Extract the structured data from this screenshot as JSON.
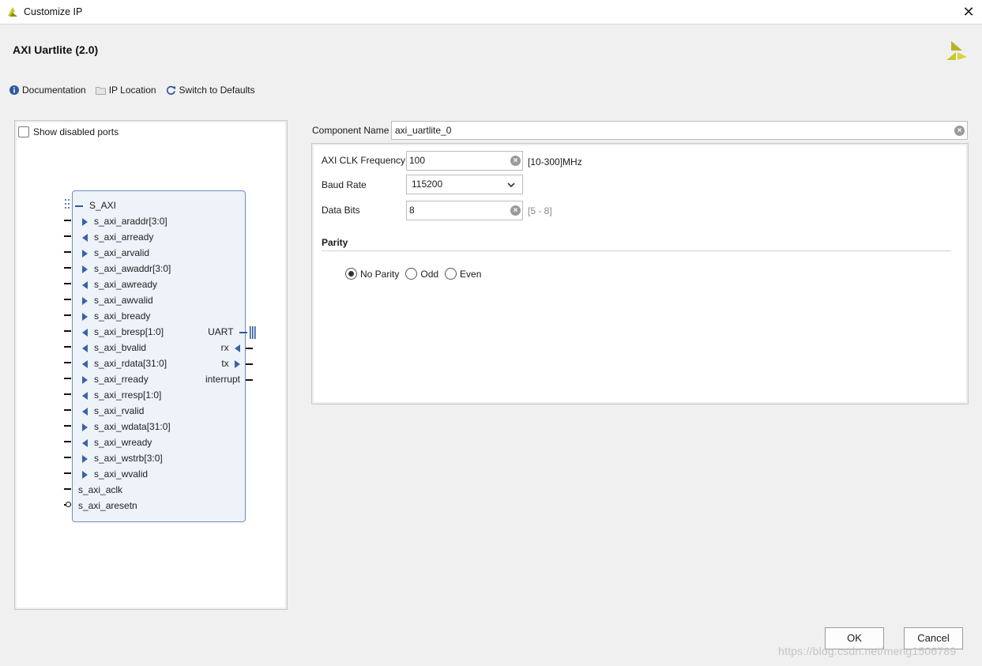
{
  "window": {
    "title": "Customize IP",
    "close_glyph": "✕"
  },
  "header": {
    "title": "AXI Uartlite (2.0)"
  },
  "toolbar": {
    "documentation": "Documentation",
    "ip_location": "IP Location",
    "switch_defaults": "Switch to Defaults"
  },
  "left_panel": {
    "show_disabled_ports": "Show disabled ports",
    "block": {
      "bus_label": "S_AXI",
      "left_ports": [
        {
          "label": "s_axi_araddr[3:0]",
          "dir": "in"
        },
        {
          "label": "s_axi_arready",
          "dir": "out"
        },
        {
          "label": "s_axi_arvalid",
          "dir": "in"
        },
        {
          "label": "s_axi_awaddr[3:0]",
          "dir": "in"
        },
        {
          "label": "s_axi_awready",
          "dir": "out"
        },
        {
          "label": "s_axi_awvalid",
          "dir": "in"
        },
        {
          "label": "s_axi_bready",
          "dir": "in"
        },
        {
          "label": "s_axi_bresp[1:0]",
          "dir": "out"
        },
        {
          "label": "s_axi_bvalid",
          "dir": "out"
        },
        {
          "label": "s_axi_rdata[31:0]",
          "dir": "out"
        },
        {
          "label": "s_axi_rready",
          "dir": "in"
        },
        {
          "label": "s_axi_rresp[1:0]",
          "dir": "out"
        },
        {
          "label": "s_axi_rvalid",
          "dir": "out"
        },
        {
          "label": "s_axi_wdata[31:0]",
          "dir": "in"
        },
        {
          "label": "s_axi_wready",
          "dir": "out"
        },
        {
          "label": "s_axi_wstrb[3:0]",
          "dir": "in"
        },
        {
          "label": "s_axi_wvalid",
          "dir": "in"
        },
        {
          "label": "s_axi_aclk",
          "dir": "none"
        },
        {
          "label": "s_axi_aresetn",
          "dir": "none"
        }
      ],
      "right_ports": {
        "uart": "UART",
        "rx": "rx",
        "tx": "tx",
        "interrupt": "interrupt"
      }
    }
  },
  "component": {
    "label": "Component Name",
    "value": "axi_uartlite_0"
  },
  "params": {
    "clk": {
      "label": "AXI CLK Frequency",
      "value": "100",
      "range": "[10-300]MHz"
    },
    "baud": {
      "label": "Baud Rate",
      "value": "115200"
    },
    "data_bits": {
      "label": "Data Bits",
      "value": "8",
      "range": "[5 - 8]"
    },
    "parity": {
      "section": "Parity",
      "options": [
        "No Parity",
        "Odd",
        "Even"
      ],
      "selected": "No Parity"
    }
  },
  "buttons": {
    "ok": "OK",
    "cancel": "Cancel"
  },
  "watermark": "https://blog.csdn.net/meng1506789",
  "colors": {
    "block_fill": "#eef3f9",
    "block_border": "#6d8ec4",
    "port_arrow": "#3a63a6",
    "logo": "#c9c72f"
  }
}
